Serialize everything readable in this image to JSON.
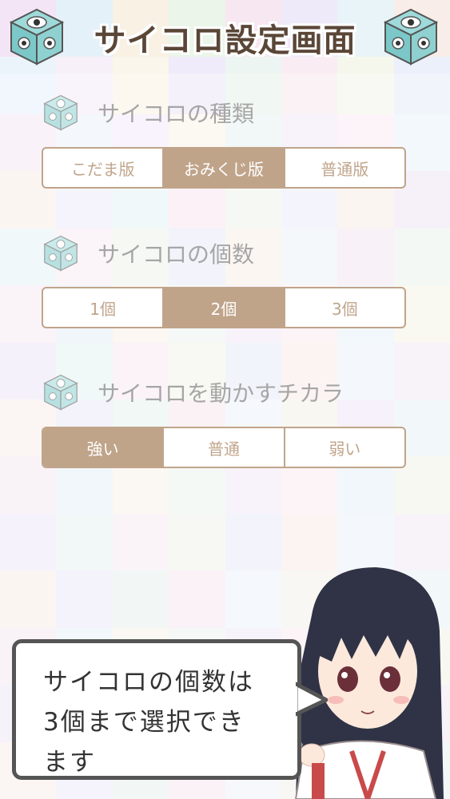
{
  "header": {
    "title": "サイコロ設定画面"
  },
  "sections": [
    {
      "label": "サイコロの種類",
      "options": [
        "こだま版",
        "おみくじ版",
        "普通版"
      ],
      "selected_index": 1
    },
    {
      "label": "サイコロの個数",
      "options": [
        "1個",
        "2個",
        "3個"
      ],
      "selected_index": 1
    },
    {
      "label": "サイコロを動かすチカラ",
      "options": [
        "強い",
        "普通",
        "弱い"
      ],
      "selected_index": 0
    }
  ],
  "tip": {
    "line1": "サイコロの個数は",
    "line2": "3個まで選択でき",
    "line3": "ます"
  },
  "colors": {
    "accent": "#8c5a2b",
    "selected_text": "#ffffff",
    "label_text": "#5e5e5e",
    "bubble_border": "#555555",
    "title_text": "#5a4637"
  },
  "icons": {
    "header_left": "dice-icon",
    "header_right": "dice-icon",
    "section": "dice-icon",
    "character": "shrine-maiden-character"
  }
}
